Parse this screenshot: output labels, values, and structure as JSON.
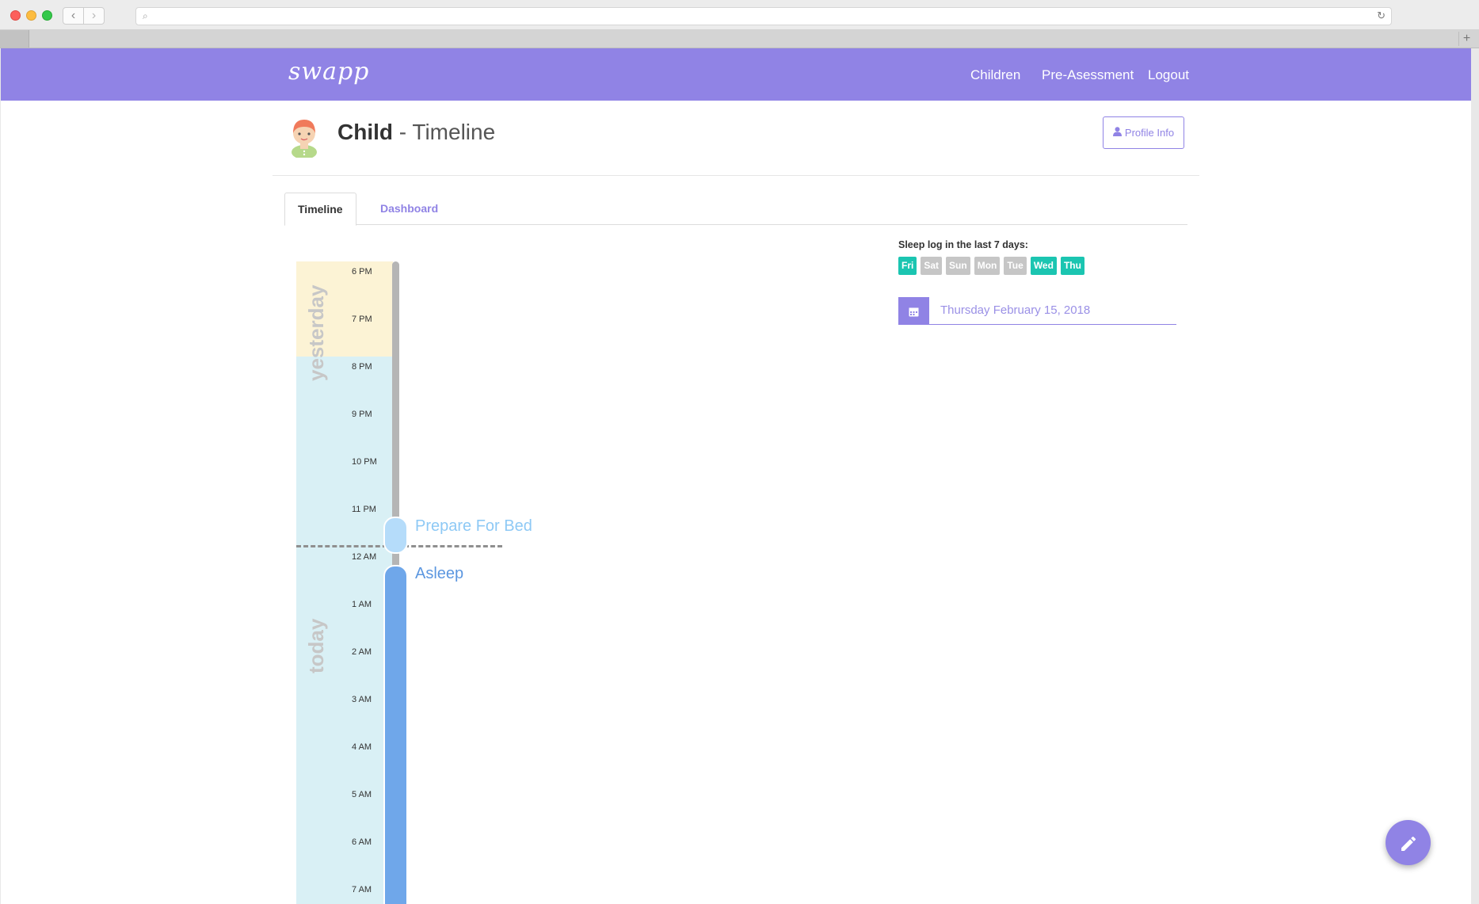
{
  "browser": {
    "url": "",
    "back_glyph": "‹",
    "forward_glyph": "›",
    "search_glyph": "⌕",
    "reload_glyph": "↻",
    "new_tab_glyph": "+"
  },
  "app": {
    "brand": "swapp",
    "nav": {
      "children": "Children",
      "pre_assessment": "Pre-Asessment",
      "logout": "Logout"
    },
    "colors": {
      "primary": "#9083e5",
      "day_logged": "#1bc5b1",
      "day_missing": "#c6c6c6",
      "asleep": "#6fa7ea",
      "prepare": "#b5dcfa"
    }
  },
  "page": {
    "title_bold": "Child",
    "title_sep": " - ",
    "title_rest": "Timeline",
    "profile_button": "Profile Info",
    "profile_icon": "user-icon"
  },
  "tabs": {
    "timeline": "Timeline",
    "dashboard": "Dashboard"
  },
  "timeline": {
    "yesterday_label": "yesterday",
    "today_label": "today",
    "ticks": [
      "6 PM",
      "7 PM",
      "8 PM",
      "9 PM",
      "10 PM",
      "11 PM",
      "12 AM",
      "1 AM",
      "2 AM",
      "3 AM",
      "4 AM",
      "5 AM",
      "6 AM",
      "7 AM"
    ],
    "events": {
      "prepare": "Prepare For Bed",
      "asleep": "Asleep"
    }
  },
  "sleep_log": {
    "title": "Sleep log in the last 7 days:",
    "days": [
      {
        "label": "Fri",
        "logged": true
      },
      {
        "label": "Sat",
        "logged": false
      },
      {
        "label": "Sun",
        "logged": false
      },
      {
        "label": "Mon",
        "logged": false
      },
      {
        "label": "Tue",
        "logged": false
      },
      {
        "label": "Wed",
        "logged": true
      },
      {
        "label": "Thu",
        "logged": true
      }
    ],
    "date": "Thursday February 15, 2018",
    "calendar_icon": "calendar-icon"
  },
  "fab": {
    "icon": "pencil-icon"
  }
}
